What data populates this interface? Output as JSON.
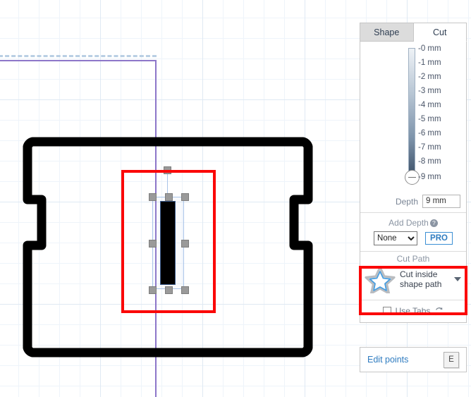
{
  "app": {
    "canvas_background": "#ffffff",
    "grid_color": "#dfe9f3",
    "accent_color": "#2f7cc0",
    "annotation_color": "#fb0707"
  },
  "panel": {
    "tabs": [
      {
        "label": "Shape",
        "active": false
      },
      {
        "label": "Cut",
        "active": true
      }
    ],
    "depth_slider": {
      "icon": "slider-minus-handle-icon",
      "ticks": [
        "-0 mm",
        "-1 mm",
        "-2 mm",
        "-3 mm",
        "-4 mm",
        "-5 mm",
        "-6 mm",
        "-7 mm",
        "-8 mm",
        "-9 mm"
      ],
      "value_label": "-9 mm"
    },
    "depth": {
      "label": "Depth",
      "value": "9 mm",
      "placeholder": "mm"
    },
    "add_depth": {
      "title": "Add Depth",
      "help_icon": "question-mark-icon",
      "help_glyph": "?",
      "select_value": "None",
      "select_options": [
        "None"
      ],
      "pro_label": "PRO"
    },
    "cut_path": {
      "title": "Cut Path",
      "icon": "star-icon",
      "value": "Cut inside shape path",
      "value_line1": "Cut inside",
      "value_line2": "shape path",
      "caret_icon": "chevron-down-icon",
      "highlighted": true
    },
    "use_tabs": {
      "label": "Use Tabs",
      "checked": false,
      "refresh_icon": "refresh-icon",
      "refresh_glyph": "↻"
    },
    "edit_points": {
      "label": "Edit points",
      "shortcut_key": "E"
    }
  },
  "canvas": {
    "shape": {
      "name": "tray-outline-path",
      "stroke_color": "#000000",
      "stroke_width": "13"
    },
    "selected_object": {
      "name": "black-rectangle",
      "fill": "#000000",
      "selection_outline": "#a9c4e8",
      "handle_color": "#9a9a9a",
      "handles": 8,
      "rotation_handle": true
    },
    "guides": {
      "vertical_color": "#8d76c9",
      "horizontal_color": "#8d76c9",
      "dashed_color": "#b9cfe4"
    },
    "annotation_boxes": [
      {
        "name": "canvas-highlight-box",
        "color": "#fb0707"
      },
      {
        "name": "cut-path-highlight-box",
        "color": "#fb0707"
      }
    ]
  }
}
